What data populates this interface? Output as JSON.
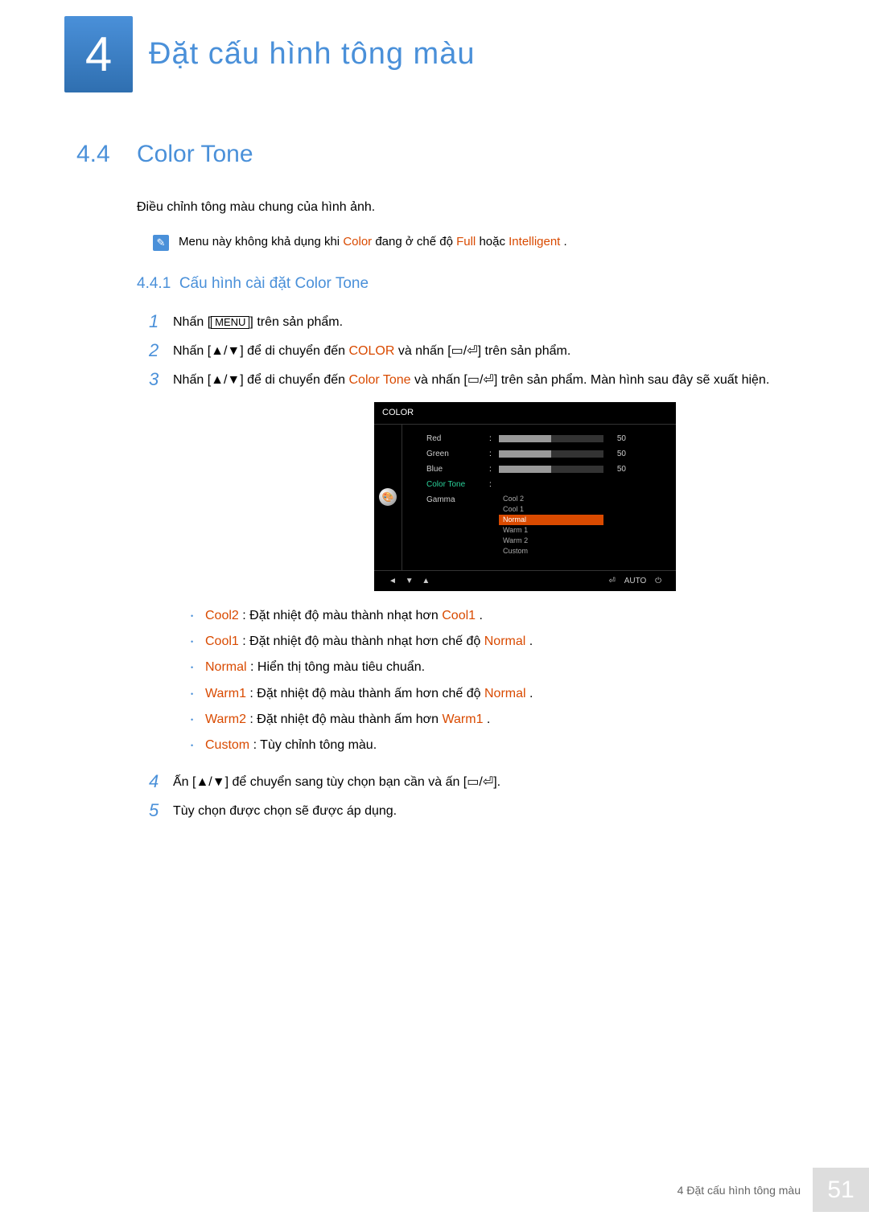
{
  "chapter": {
    "number": "4",
    "title": "Đặt cấu hình tông màu"
  },
  "section": {
    "number": "4.4",
    "title": "Color Tone"
  },
  "intro": "Điều chỉnh tông màu chung của hình ảnh.",
  "note": {
    "pre": "Menu này không khả dụng khi ",
    "hl1": "Color",
    "mid": " đang ở chế độ ",
    "hl2": "Full",
    "mid2": " hoặc ",
    "hl3": "Intelligent",
    "post": " ."
  },
  "subsection": {
    "number": "4.4.1",
    "title": "Cấu hình cài đặt Color Tone"
  },
  "steps": {
    "1": {
      "pre": "Nhấn [",
      "btn": "MENU",
      "post": "] trên sản phẩm."
    },
    "2": {
      "pre": "Nhấn [",
      "glyph1": "▲/▼",
      "mid1": "] để di chuyển đến ",
      "hl1": "COLOR",
      "mid2": " và nhấn [",
      "glyph2": "▭/⏎",
      "post": "] trên sản phẩm."
    },
    "3": {
      "pre": "Nhấn [",
      "glyph1": "▲/▼",
      "mid1": "] để di chuyển đến ",
      "hl1": "Color Tone",
      "mid2": " và nhấn [",
      "glyph2": "▭/⏎",
      "post": "] trên sản phẩm. Màn hình sau đây sẽ xuất hiện."
    },
    "4": {
      "pre": "Ấn [",
      "glyph1": "▲/▼",
      "mid": "] để chuyển sang tùy chọn bạn cần và ấn [",
      "glyph2": "▭/⏎",
      "post": "]."
    },
    "5": {
      "text": "Tùy chọn được chọn sẽ được áp dụng."
    }
  },
  "osd": {
    "title": "COLOR",
    "rows": {
      "r1": {
        "label": "Red",
        "val": "50"
      },
      "r2": {
        "label": "Green",
        "val": "50"
      },
      "r3": {
        "label": "Blue",
        "val": "50"
      },
      "r4": {
        "label": "Color Tone"
      },
      "r5": {
        "label": "Gamma"
      }
    },
    "options": {
      "o1": "Cool 2",
      "o2": "Cool 1",
      "o3": "Normal",
      "o4": "Warm 1",
      "o5": "Warm 2",
      "o6": "Custom"
    },
    "footer": {
      "auto": "AUTO"
    }
  },
  "bullets": {
    "b1": {
      "hl1": "Cool2",
      "mid": " : Đặt nhiệt độ màu thành nhạt hơn ",
      "hl2": "Cool1",
      "post": " ."
    },
    "b2": {
      "hl1": "Cool1",
      "mid": " : Đặt nhiệt độ màu thành nhạt hơn chế độ ",
      "hl2": "Normal",
      "post": " ."
    },
    "b3": {
      "hl1": "Normal",
      "post": " : Hiển thị tông màu tiêu chuẩn."
    },
    "b4": {
      "hl1": "Warm1",
      "mid": " : Đặt nhiệt độ màu thành ấm hơn chế độ ",
      "hl2": "Normal",
      "post": " ."
    },
    "b5": {
      "hl1": "Warm2",
      "mid": " : Đặt nhiệt độ màu thành ấm hơn ",
      "hl2": "Warm1",
      "post": " ."
    },
    "b6": {
      "hl1": "Custom",
      "post": " : Tùy chỉnh tông màu."
    }
  },
  "footer": {
    "text": "4 Đặt cấu hình tông màu",
    "page": "51"
  }
}
